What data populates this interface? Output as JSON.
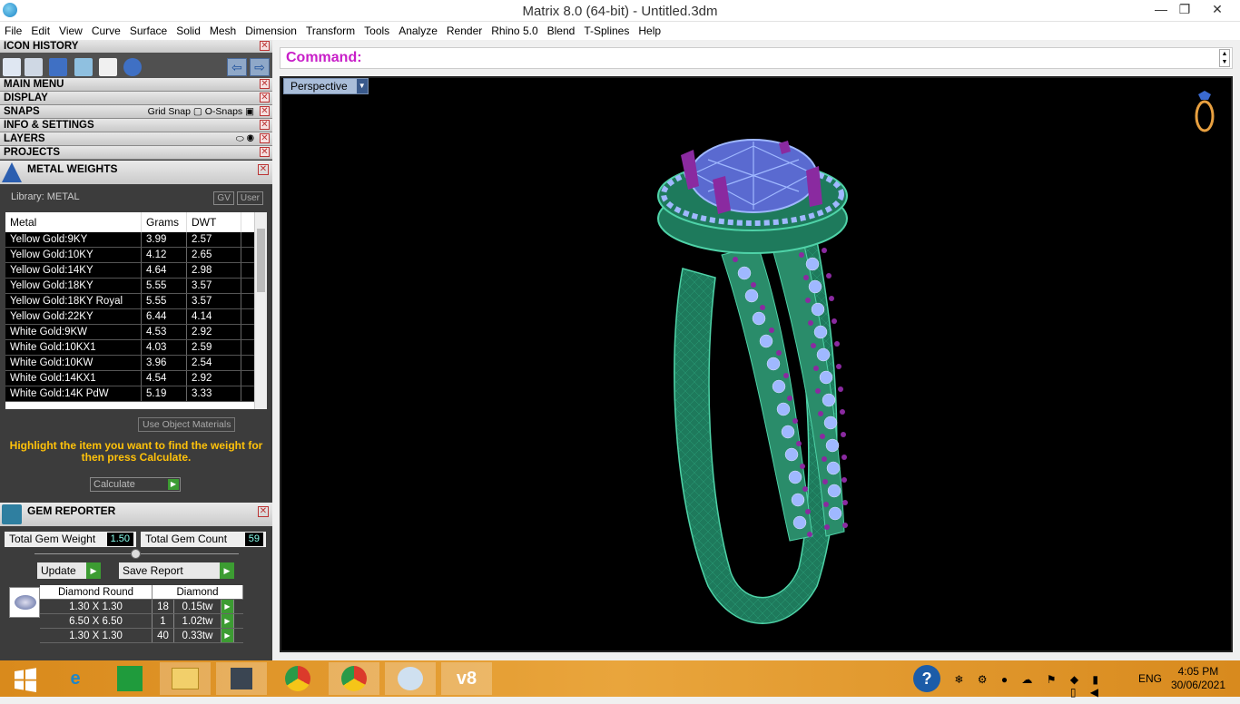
{
  "window": {
    "title": "Matrix 8.0 (64-bit) - Untitled.3dm",
    "minimize": "—",
    "maximize": "❐",
    "close": "✕"
  },
  "menu": [
    "File",
    "Edit",
    "View",
    "Curve",
    "Surface",
    "Solid",
    "Mesh",
    "Dimension",
    "Transform",
    "Tools",
    "Analyze",
    "Render",
    "Rhino 5.0",
    "Blend",
    "T-Splines",
    "Help"
  ],
  "panels": {
    "icon_history": "ICON HISTORY",
    "main_menu": "MAIN MENU",
    "display": "DISPLAY",
    "snaps": "SNAPS",
    "grid_snap": "Grid Snap",
    "o_snaps": "O-Snaps",
    "info_settings": "INFO & SETTINGS",
    "layers": "LAYERS",
    "projects": "PROJECTS",
    "close_glyph": "✕",
    "back_glyph": "⇦",
    "forward_glyph": "⇨"
  },
  "metal_weights": {
    "title": "METAL WEIGHTS",
    "library": "Library: METAL",
    "gv": "GV",
    "user": "User",
    "columns": [
      "Metal",
      "Grams",
      "DWT"
    ],
    "rows": [
      [
        "Yellow Gold:9KY",
        "3.99",
        "2.57"
      ],
      [
        "Yellow Gold:10KY",
        "4.12",
        "2.65"
      ],
      [
        "Yellow Gold:14KY",
        "4.64",
        "2.98"
      ],
      [
        "Yellow Gold:18KY",
        "5.55",
        "3.57"
      ],
      [
        "Yellow Gold:18KY Royal",
        "5.55",
        "3.57"
      ],
      [
        "Yellow Gold:22KY",
        "6.44",
        "4.14"
      ],
      [
        "White Gold:9KW",
        "4.53",
        "2.92"
      ],
      [
        "White Gold:10KX1",
        "4.03",
        "2.59"
      ],
      [
        "White Gold:10KW",
        "3.96",
        "2.54"
      ],
      [
        "White Gold:14KX1",
        "4.54",
        "2.92"
      ],
      [
        "White Gold:14K PdW",
        "5.19",
        "3.33"
      ]
    ],
    "use_object": "Use Object Materials",
    "hint": "Highlight the item you want to find the weight for then press Calculate.",
    "calculate": "Calculate"
  },
  "gem_reporter": {
    "title": "GEM REPORTER",
    "total_weight_label": "Total Gem Weight",
    "total_weight": "1.50",
    "total_count_label": "Total Gem Count",
    "total_count": "59",
    "update": "Update",
    "save_report": "Save Report",
    "header": [
      "Diamond Round",
      "Diamond"
    ],
    "rows": [
      [
        "1.30 X 1.30",
        "18",
        "0.15tw"
      ],
      [
        "6.50 X 6.50",
        "1",
        "1.02tw"
      ],
      [
        "1.30 X 1.30",
        "40",
        "0.33tw"
      ]
    ]
  },
  "command": {
    "label": "Command:"
  },
  "viewport": {
    "name": "Perspective"
  },
  "taskbar": {
    "time": "4:05 PM",
    "date": "30/06/2021",
    "lang": "ENG"
  },
  "colors": {
    "metal": "#1e7a5c",
    "gem": "#9fb8ff",
    "prong": "#8a2aa0",
    "viewport_bg": "#000000"
  }
}
